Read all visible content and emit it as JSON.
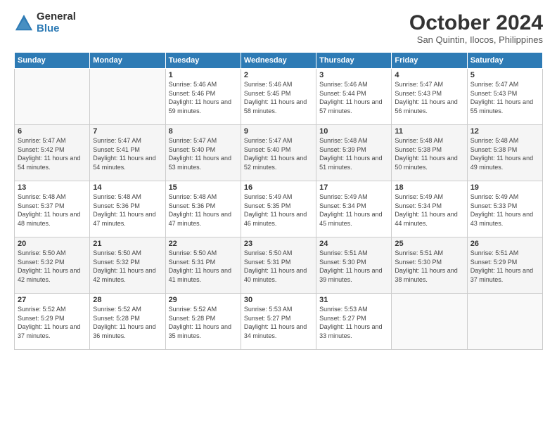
{
  "logo": {
    "general": "General",
    "blue": "Blue"
  },
  "header": {
    "month": "October 2024",
    "location": "San Quintin, Ilocos, Philippines"
  },
  "weekdays": [
    "Sunday",
    "Monday",
    "Tuesday",
    "Wednesday",
    "Thursday",
    "Friday",
    "Saturday"
  ],
  "weeks": [
    [
      {
        "day": "",
        "sunrise": "",
        "sunset": "",
        "daylight": ""
      },
      {
        "day": "",
        "sunrise": "",
        "sunset": "",
        "daylight": ""
      },
      {
        "day": "1",
        "sunrise": "Sunrise: 5:46 AM",
        "sunset": "Sunset: 5:46 PM",
        "daylight": "Daylight: 11 hours and 59 minutes."
      },
      {
        "day": "2",
        "sunrise": "Sunrise: 5:46 AM",
        "sunset": "Sunset: 5:45 PM",
        "daylight": "Daylight: 11 hours and 58 minutes."
      },
      {
        "day": "3",
        "sunrise": "Sunrise: 5:46 AM",
        "sunset": "Sunset: 5:44 PM",
        "daylight": "Daylight: 11 hours and 57 minutes."
      },
      {
        "day": "4",
        "sunrise": "Sunrise: 5:47 AM",
        "sunset": "Sunset: 5:43 PM",
        "daylight": "Daylight: 11 hours and 56 minutes."
      },
      {
        "day": "5",
        "sunrise": "Sunrise: 5:47 AM",
        "sunset": "Sunset: 5:43 PM",
        "daylight": "Daylight: 11 hours and 55 minutes."
      }
    ],
    [
      {
        "day": "6",
        "sunrise": "Sunrise: 5:47 AM",
        "sunset": "Sunset: 5:42 PM",
        "daylight": "Daylight: 11 hours and 54 minutes."
      },
      {
        "day": "7",
        "sunrise": "Sunrise: 5:47 AM",
        "sunset": "Sunset: 5:41 PM",
        "daylight": "Daylight: 11 hours and 54 minutes."
      },
      {
        "day": "8",
        "sunrise": "Sunrise: 5:47 AM",
        "sunset": "Sunset: 5:40 PM",
        "daylight": "Daylight: 11 hours and 53 minutes."
      },
      {
        "day": "9",
        "sunrise": "Sunrise: 5:47 AM",
        "sunset": "Sunset: 5:40 PM",
        "daylight": "Daylight: 11 hours and 52 minutes."
      },
      {
        "day": "10",
        "sunrise": "Sunrise: 5:48 AM",
        "sunset": "Sunset: 5:39 PM",
        "daylight": "Daylight: 11 hours and 51 minutes."
      },
      {
        "day": "11",
        "sunrise": "Sunrise: 5:48 AM",
        "sunset": "Sunset: 5:38 PM",
        "daylight": "Daylight: 11 hours and 50 minutes."
      },
      {
        "day": "12",
        "sunrise": "Sunrise: 5:48 AM",
        "sunset": "Sunset: 5:38 PM",
        "daylight": "Daylight: 11 hours and 49 minutes."
      }
    ],
    [
      {
        "day": "13",
        "sunrise": "Sunrise: 5:48 AM",
        "sunset": "Sunset: 5:37 PM",
        "daylight": "Daylight: 11 hours and 48 minutes."
      },
      {
        "day": "14",
        "sunrise": "Sunrise: 5:48 AM",
        "sunset": "Sunset: 5:36 PM",
        "daylight": "Daylight: 11 hours and 47 minutes."
      },
      {
        "day": "15",
        "sunrise": "Sunrise: 5:48 AM",
        "sunset": "Sunset: 5:36 PM",
        "daylight": "Daylight: 11 hours and 47 minutes."
      },
      {
        "day": "16",
        "sunrise": "Sunrise: 5:49 AM",
        "sunset": "Sunset: 5:35 PM",
        "daylight": "Daylight: 11 hours and 46 minutes."
      },
      {
        "day": "17",
        "sunrise": "Sunrise: 5:49 AM",
        "sunset": "Sunset: 5:34 PM",
        "daylight": "Daylight: 11 hours and 45 minutes."
      },
      {
        "day": "18",
        "sunrise": "Sunrise: 5:49 AM",
        "sunset": "Sunset: 5:34 PM",
        "daylight": "Daylight: 11 hours and 44 minutes."
      },
      {
        "day": "19",
        "sunrise": "Sunrise: 5:49 AM",
        "sunset": "Sunset: 5:33 PM",
        "daylight": "Daylight: 11 hours and 43 minutes."
      }
    ],
    [
      {
        "day": "20",
        "sunrise": "Sunrise: 5:50 AM",
        "sunset": "Sunset: 5:32 PM",
        "daylight": "Daylight: 11 hours and 42 minutes."
      },
      {
        "day": "21",
        "sunrise": "Sunrise: 5:50 AM",
        "sunset": "Sunset: 5:32 PM",
        "daylight": "Daylight: 11 hours and 42 minutes."
      },
      {
        "day": "22",
        "sunrise": "Sunrise: 5:50 AM",
        "sunset": "Sunset: 5:31 PM",
        "daylight": "Daylight: 11 hours and 41 minutes."
      },
      {
        "day": "23",
        "sunrise": "Sunrise: 5:50 AM",
        "sunset": "Sunset: 5:31 PM",
        "daylight": "Daylight: 11 hours and 40 minutes."
      },
      {
        "day": "24",
        "sunrise": "Sunrise: 5:51 AM",
        "sunset": "Sunset: 5:30 PM",
        "daylight": "Daylight: 11 hours and 39 minutes."
      },
      {
        "day": "25",
        "sunrise": "Sunrise: 5:51 AM",
        "sunset": "Sunset: 5:30 PM",
        "daylight": "Daylight: 11 hours and 38 minutes."
      },
      {
        "day": "26",
        "sunrise": "Sunrise: 5:51 AM",
        "sunset": "Sunset: 5:29 PM",
        "daylight": "Daylight: 11 hours and 37 minutes."
      }
    ],
    [
      {
        "day": "27",
        "sunrise": "Sunrise: 5:52 AM",
        "sunset": "Sunset: 5:29 PM",
        "daylight": "Daylight: 11 hours and 37 minutes."
      },
      {
        "day": "28",
        "sunrise": "Sunrise: 5:52 AM",
        "sunset": "Sunset: 5:28 PM",
        "daylight": "Daylight: 11 hours and 36 minutes."
      },
      {
        "day": "29",
        "sunrise": "Sunrise: 5:52 AM",
        "sunset": "Sunset: 5:28 PM",
        "daylight": "Daylight: 11 hours and 35 minutes."
      },
      {
        "day": "30",
        "sunrise": "Sunrise: 5:53 AM",
        "sunset": "Sunset: 5:27 PM",
        "daylight": "Daylight: 11 hours and 34 minutes."
      },
      {
        "day": "31",
        "sunrise": "Sunrise: 5:53 AM",
        "sunset": "Sunset: 5:27 PM",
        "daylight": "Daylight: 11 hours and 33 minutes."
      },
      {
        "day": "",
        "sunrise": "",
        "sunset": "",
        "daylight": ""
      },
      {
        "day": "",
        "sunrise": "",
        "sunset": "",
        "daylight": ""
      }
    ]
  ]
}
